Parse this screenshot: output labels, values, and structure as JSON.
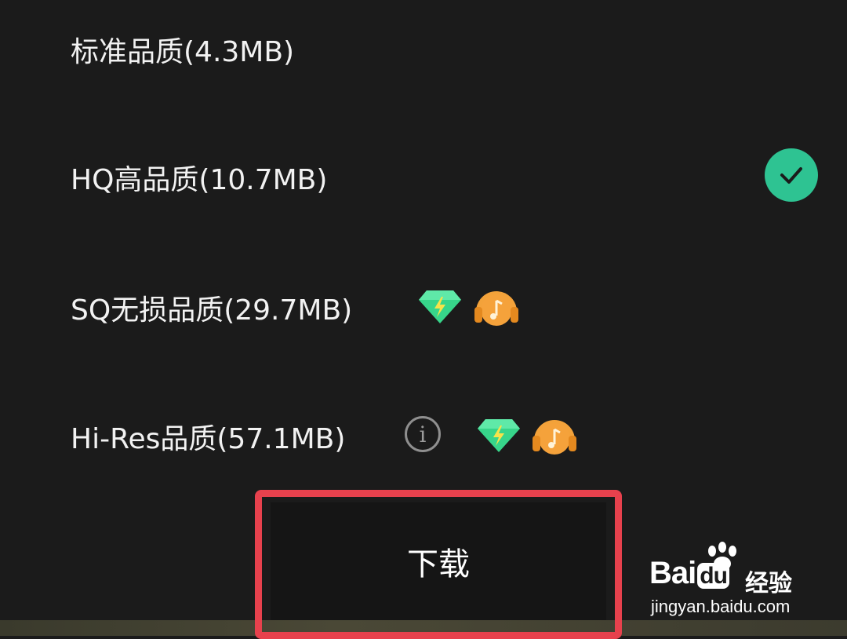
{
  "quality_options": [
    {
      "label": "标准品质(4.3MB)",
      "selected": false
    },
    {
      "label": "HQ高品质(10.7MB)",
      "selected": true
    },
    {
      "label": "SQ无损品质(29.7MB)",
      "selected": false,
      "badges": [
        "green-diamond-icon",
        "orange-headphone-music-icon"
      ]
    },
    {
      "label": "Hi-Res品质(57.1MB)",
      "selected": false,
      "info": "i",
      "badges": [
        "green-diamond-icon",
        "orange-headphone-music-icon"
      ]
    }
  ],
  "download": {
    "label": "下载"
  },
  "colors": {
    "accent_green": "#2ec392",
    "highlight_red": "#e7414d",
    "badge_orange": "#f5a23b",
    "diamond_green": "#37d58a"
  },
  "watermark": {
    "brand": "Bai",
    "brand2": "du",
    "suffix": "经验",
    "url": "jingyan.baidu.com"
  }
}
